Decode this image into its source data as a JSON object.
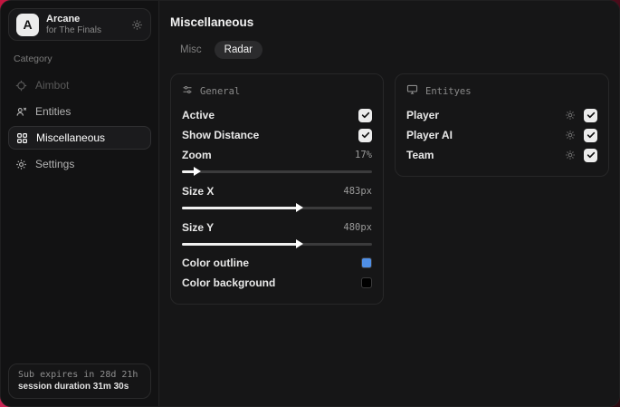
{
  "app": {
    "logo_letter": "A",
    "name": "Arcane",
    "subtitle": "for The Finals"
  },
  "sidebar": {
    "category_label": "Category",
    "items": [
      {
        "label": "Aimbot"
      },
      {
        "label": "Entities"
      },
      {
        "label": "Miscellaneous"
      },
      {
        "label": "Settings"
      }
    ],
    "footer": {
      "sub_expires": "Sub expires in 28d 21h",
      "session_duration": "session duration 31m 30s"
    }
  },
  "header": {
    "title": "Miscellaneous"
  },
  "tabs": [
    {
      "label": "Misc"
    },
    {
      "label": "Radar"
    }
  ],
  "panels": {
    "general": {
      "title": "General",
      "active": {
        "label": "Active",
        "checked": true
      },
      "show_distance": {
        "label": "Show Distance",
        "checked": true
      },
      "zoom": {
        "label": "Zoom",
        "value": "17%",
        "percent": 7
      },
      "size_x": {
        "label": "Size X",
        "value": "483px",
        "percent": 61
      },
      "size_y": {
        "label": "Size Y",
        "value": "480px",
        "percent": 61
      },
      "color_outline": {
        "label": "Color outline",
        "color": "#4f8fe6"
      },
      "color_background": {
        "label": "Color background",
        "color": "#000000"
      }
    },
    "entities": {
      "title": "Entityes",
      "rows": [
        {
          "label": "Player",
          "checked": true
        },
        {
          "label": "Player AI",
          "checked": true
        },
        {
          "label": "Team",
          "checked": true
        }
      ]
    }
  },
  "colors": {
    "accent_blue": "#4f8fe6",
    "backdrop_red": "#c2153f"
  }
}
